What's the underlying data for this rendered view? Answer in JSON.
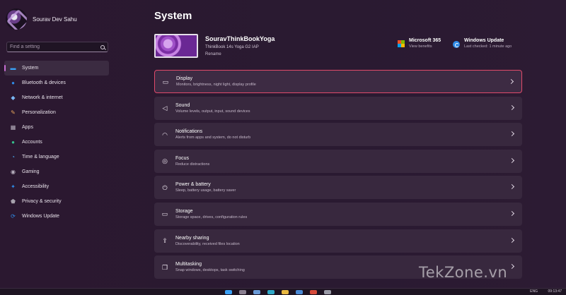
{
  "profile": {
    "name": "Sourav Dev Sahu"
  },
  "search": {
    "placeholder": "Find a setting"
  },
  "sidebar": {
    "items": [
      {
        "label": "System",
        "icon": "monitor-icon",
        "color": "#3aa0f5"
      },
      {
        "label": "Bluetooth & devices",
        "icon": "bluetooth-icon",
        "color": "#2f8be8"
      },
      {
        "label": "Network & internet",
        "icon": "wifi-icon",
        "color": "#7ab8f5"
      },
      {
        "label": "Personalization",
        "icon": "brush-icon",
        "color": "#e6a35c"
      },
      {
        "label": "Apps",
        "icon": "apps-icon",
        "color": "#b9b2c0"
      },
      {
        "label": "Accounts",
        "icon": "person-icon",
        "color": "#35c08c"
      },
      {
        "label": "Time & language",
        "icon": "globe-clock-icon",
        "color": "#4aa9f0"
      },
      {
        "label": "Gaming",
        "icon": "gamepad-icon",
        "color": "#b9b2c0"
      },
      {
        "label": "Accessibility",
        "icon": "accessibility-icon",
        "color": "#2f8be8"
      },
      {
        "label": "Privacy & security",
        "icon": "shield-icon",
        "color": "#a7a2ad"
      },
      {
        "label": "Windows Update",
        "icon": "update-icon",
        "color": "#2f8be8"
      }
    ]
  },
  "main": {
    "title": "System",
    "device": {
      "name": "SouravThinkBookYoga",
      "model": "ThinkBook 14s Yoga G2 IAP",
      "rename": "Rename"
    },
    "microsoft365": {
      "title": "Microsoft 365",
      "sub": "View benefits"
    },
    "windows_update": {
      "title": "Windows Update",
      "sub": "Last checked: 1 minute ago"
    },
    "cards": [
      {
        "title": "Display",
        "desc": "Monitors, brightness, night light, display profile",
        "icon": "display-icon"
      },
      {
        "title": "Sound",
        "desc": "Volume levels, output, input, sound devices",
        "icon": "speaker-icon"
      },
      {
        "title": "Notifications",
        "desc": "Alerts from apps and system, do not disturb",
        "icon": "bell-icon"
      },
      {
        "title": "Focus",
        "desc": "Reduce distractions",
        "icon": "focus-icon"
      },
      {
        "title": "Power & battery",
        "desc": "Sleep, battery usage, battery saver",
        "icon": "power-icon"
      },
      {
        "title": "Storage",
        "desc": "Storage space, drives, configuration rules",
        "icon": "storage-icon"
      },
      {
        "title": "Nearby sharing",
        "desc": "Discoverability, received files location",
        "icon": "share-icon"
      },
      {
        "title": "Multitasking",
        "desc": "Snap windows, desktops, task switching",
        "icon": "multitask-icon"
      }
    ]
  },
  "taskbar": {
    "lang": "ENG",
    "time": "09:13:47"
  },
  "watermark": "TekZone.vn"
}
